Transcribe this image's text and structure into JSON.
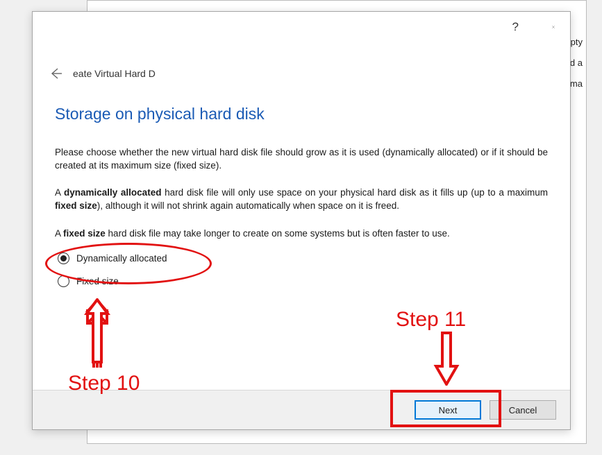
{
  "background": {
    "frag1": "mpty",
    "frag2": "ted a",
    "frag3": "forma"
  },
  "dialog": {
    "breadcrumb": "eate Virtual Hard D",
    "title": "Storage on physical hard disk",
    "para1": "Please choose whether the new virtual hard disk file should grow as it is used (dynamically allocated) or if it should be created at its maximum size (fixed size).",
    "para2_pre": "A ",
    "para2_b1": "dynamically allocated",
    "para2_mid": " hard disk file will only use space on your physical hard disk as it fills up (up to a maximum ",
    "para2_b2": "fixed size",
    "para2_post": "), although it will not shrink again automatically when space on it is freed.",
    "para3_pre": "A ",
    "para3_b": "fixed size",
    "para3_post": " hard disk file may take longer to create on some systems but is often faster to use.",
    "radio1": "Dynamically allocated",
    "radio2": "Fixed size",
    "next": "Next",
    "cancel": "Cancel",
    "help": "?"
  },
  "annotations": {
    "step10": "Step 10",
    "step11": "Step 11"
  }
}
